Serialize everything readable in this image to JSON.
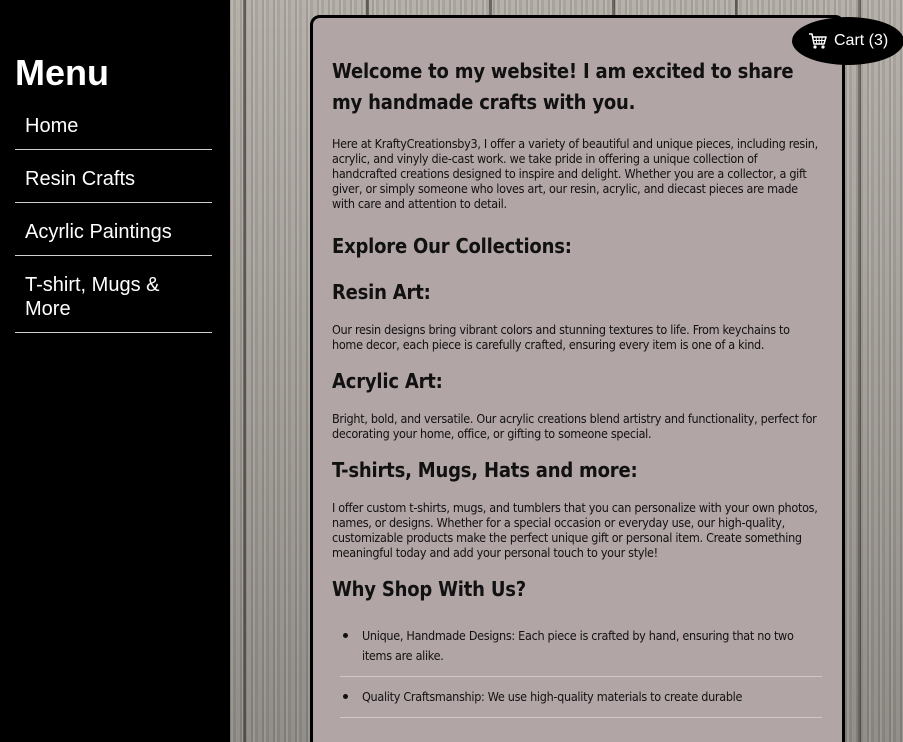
{
  "sidebar": {
    "title": "Menu",
    "items": [
      {
        "label": "Home"
      },
      {
        "label": "Resin Crafts"
      },
      {
        "label": "Acyrlic Paintings"
      },
      {
        "label": "T-shirt, Mugs & More"
      }
    ]
  },
  "cart": {
    "label": "Cart (3)",
    "icon": "shopping-cart-icon"
  },
  "content": {
    "welcome_heading": "Welcome to my website! I am excited to share my handmade crafts with you.",
    "intro": "Here at KraftyCreationsby3, I offer a variety of beautiful and unique pieces, including resin, acrylic, and vinyly die-cast work. we take pride in offering a unique collection of handcrafted creations designed to inspire and delight. Whether you are a collector, a gift giver, or simply someone who loves art, our resin, acrylic, and diecast pieces are made with care and attention to detail.",
    "explore_heading": "Explore Our Collections:",
    "resin_heading": "Resin Art:",
    "resin_text": "Our resin designs bring vibrant colors and stunning textures to life. From keychains to home decor, each piece is carefully crafted, ensuring every item is one of a kind.",
    "acrylic_heading": "Acrylic Art:",
    "acrylic_text": "Bright, bold, and versatile. Our acrylic creations blend artistry and functionality, perfect for decorating your home, office, or gifting to someone special.",
    "tshirt_heading": "T-shirts, Mugs, Hats and more:",
    "tshirt_text": "I offer custom t-shirts, mugs, and tumblers that you can personalize with your own photos, names, or designs. Whether for a special occasion or everyday use, our high-quality, customizable products make the perfect unique gift or personal item. Create something meaningful today and add your personal touch to your style!",
    "why_heading": "Why Shop With Us?",
    "why_items": [
      "Unique, Handmade Designs: Each piece is crafted by hand, ensuring that no two items are alike.",
      "Quality Craftsmanship: We use high-quality materials to create durable"
    ]
  },
  "colors": {
    "sidebar_bg": "#000000",
    "content_bg": "#b2a5a6",
    "cart_bg": "#000000"
  }
}
